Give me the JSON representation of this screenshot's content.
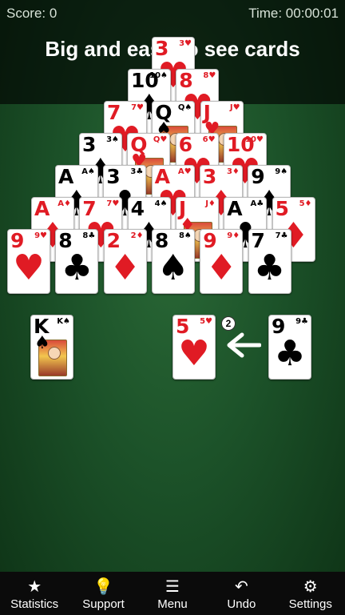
{
  "status": {
    "score": "Score: 0",
    "time": "Time: 00:00:01"
  },
  "banner": {
    "text": "Big and easy to see cards"
  },
  "colors": {
    "felt": "#1c5229",
    "red": "#e01b24",
    "black": "#000000",
    "nav_bg": "#0b0b0b"
  },
  "pyramid": [
    {
      "rank": "3",
      "suit": "♥",
      "color": "red"
    },
    {
      "rank": "10",
      "suit": "♠",
      "color": "black"
    },
    {
      "rank": "8",
      "suit": "♥",
      "color": "red"
    },
    {
      "rank": "7",
      "suit": "♥",
      "color": "red"
    },
    {
      "rank": "Q",
      "suit": "♠",
      "color": "black",
      "face": true
    },
    {
      "rank": "J",
      "suit": "♥",
      "color": "red",
      "face": true
    },
    {
      "rank": "3",
      "suit": "♠",
      "color": "black"
    },
    {
      "rank": "Q",
      "suit": "♥",
      "color": "red",
      "face": true
    },
    {
      "rank": "6",
      "suit": "♥",
      "color": "red"
    },
    {
      "rank": "10",
      "suit": "♥",
      "color": "red"
    },
    {
      "rank": "A",
      "suit": "♠",
      "color": "black"
    },
    {
      "rank": "3",
      "suit": "♣",
      "color": "black"
    },
    {
      "rank": "A",
      "suit": "♥",
      "color": "red"
    },
    {
      "rank": "3",
      "suit": "♦",
      "color": "red"
    },
    {
      "rank": "9",
      "suit": "♠",
      "color": "black"
    },
    {
      "rank": "A",
      "suit": "♦",
      "color": "red"
    },
    {
      "rank": "7",
      "suit": "♥",
      "color": "red"
    },
    {
      "rank": "4",
      "suit": "♠",
      "color": "black"
    },
    {
      "rank": "J",
      "suit": "♦",
      "color": "red",
      "face": true
    },
    {
      "rank": "A",
      "suit": "♣",
      "color": "black"
    },
    {
      "rank": "5",
      "suit": "♦",
      "color": "red"
    },
    {
      "rank": "9",
      "suit": "♥",
      "color": "red"
    },
    {
      "rank": "8",
      "suit": "♣",
      "color": "black"
    },
    {
      "rank": "2",
      "suit": "♦",
      "color": "red"
    },
    {
      "rank": "8",
      "suit": "♠",
      "color": "black"
    },
    {
      "rank": "9",
      "suit": "♦",
      "color": "red"
    },
    {
      "rank": "7",
      "suit": "♣",
      "color": "black"
    }
  ],
  "stock": {
    "rank": "K",
    "suit": "♠",
    "color": "black",
    "face": true
  },
  "waste": {
    "rank": "5",
    "suit": "♥",
    "color": "red",
    "count": "2"
  },
  "next": {
    "rank": "9",
    "suit": "♣",
    "color": "black"
  },
  "arrow_icon": "left-arrow-icon",
  "nav": [
    {
      "icon": "★",
      "icon_name": "star-icon",
      "label": "Statistics"
    },
    {
      "icon": "💡",
      "icon_name": "lightbulb-icon",
      "label": "Support"
    },
    {
      "icon": "☰",
      "icon_name": "menu-icon",
      "label": "Menu"
    },
    {
      "icon": "↶",
      "icon_name": "undo-icon",
      "label": "Undo"
    },
    {
      "icon": "⚙",
      "icon_name": "gear-icon",
      "label": "Settings"
    }
  ]
}
